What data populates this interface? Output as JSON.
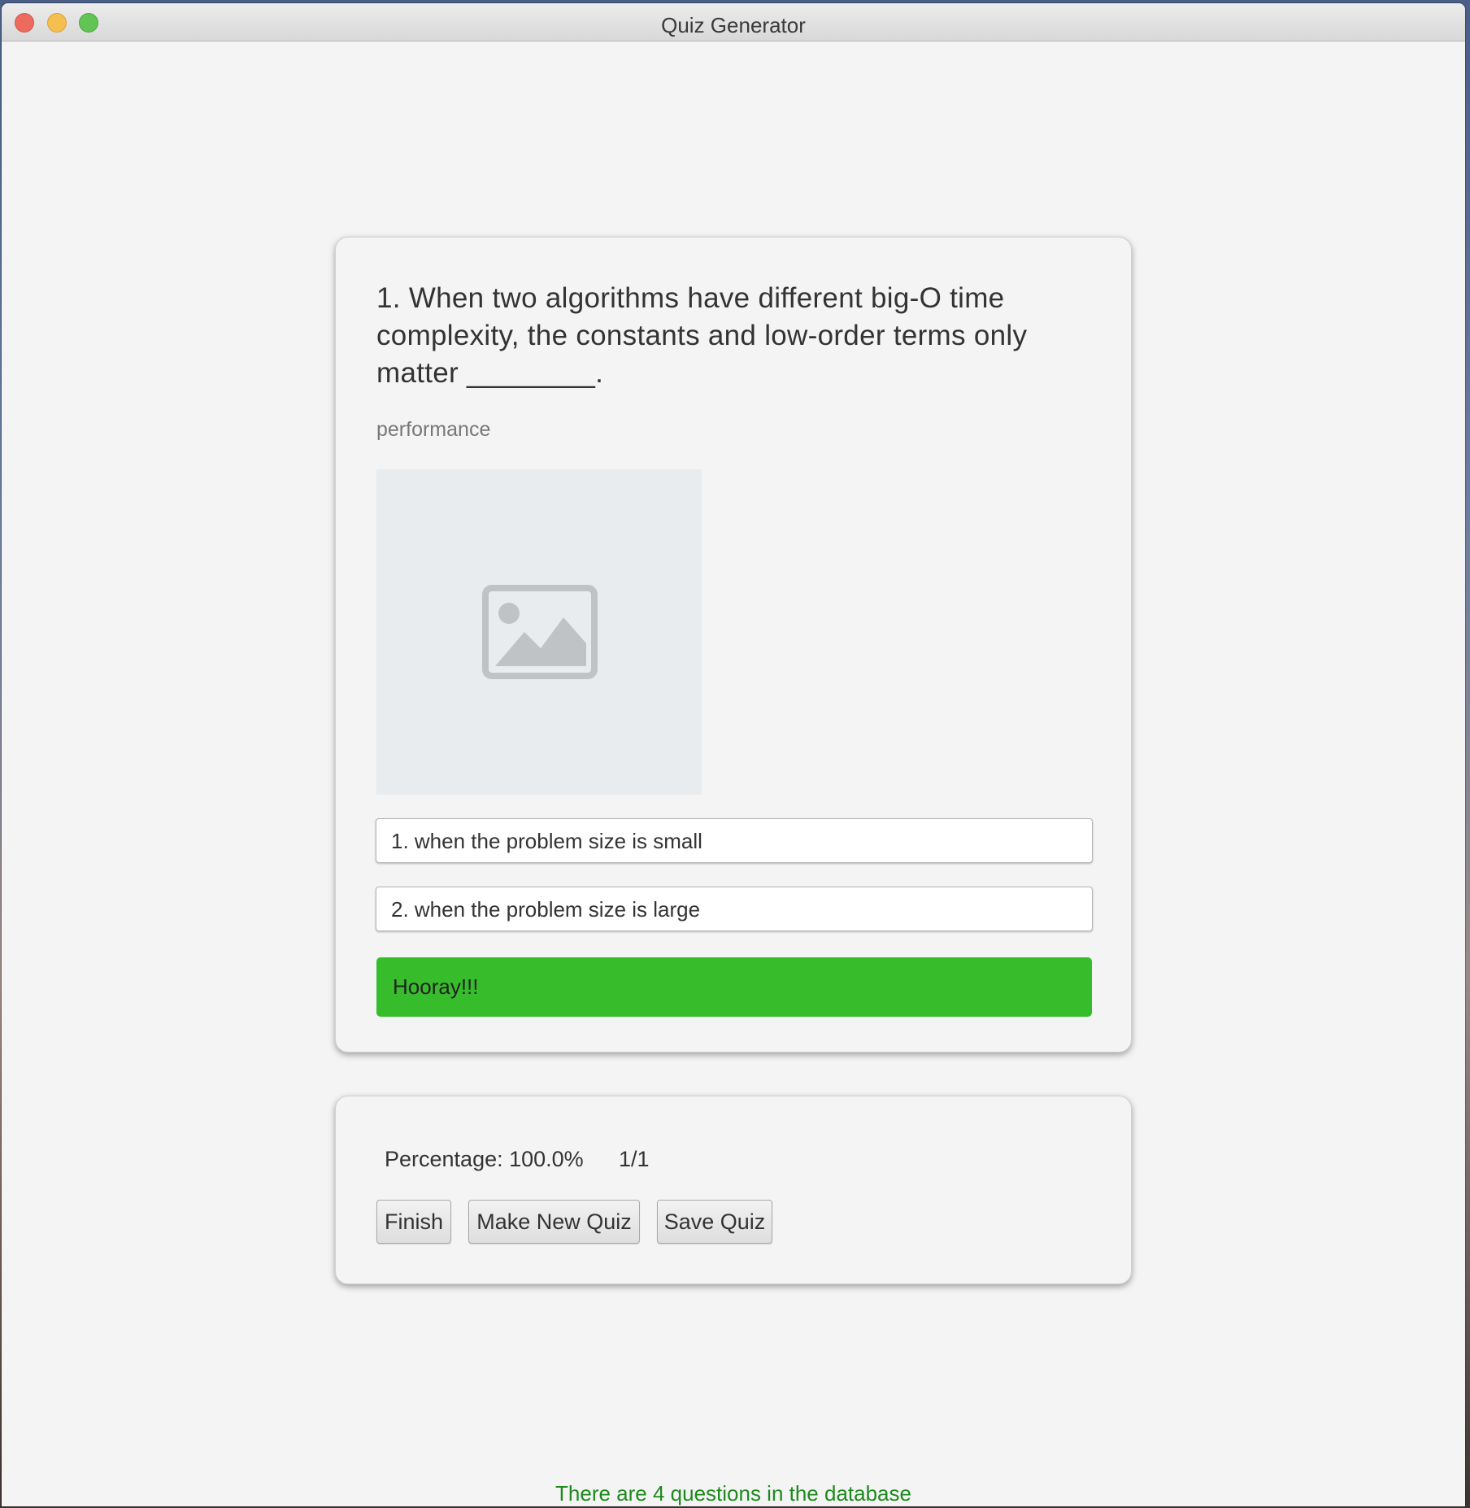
{
  "window": {
    "title": "Quiz Generator"
  },
  "question": {
    "text": "1. When two algorithms have different big-O time complexity, the constants and low-order terms only matter ________.",
    "topic": "performance",
    "image_icon": "image-placeholder-icon"
  },
  "answers": [
    {
      "label": "1. when the problem size is small"
    },
    {
      "label": "2. when the problem size is large"
    }
  ],
  "feedback": {
    "message": "Hooray!!!",
    "color": "#37bd2c"
  },
  "controls": {
    "percentage": "Percentage: 100.0%",
    "score": "1/1",
    "finish_label": "Finish",
    "new_quiz_label": "Make New Quiz",
    "save_quiz_label": "Save Quiz"
  },
  "status": {
    "db_message": "There are 4 questions in the database",
    "color": "#1e8a1e"
  }
}
